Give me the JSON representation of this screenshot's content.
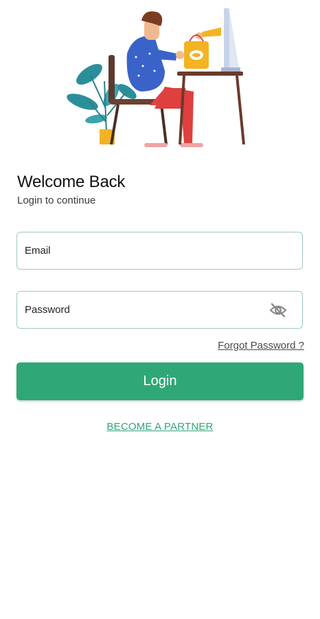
{
  "header": {
    "title": "Welcome Back",
    "subtitle": "Login to continue"
  },
  "form": {
    "email": {
      "placeholder": "Email",
      "value": ""
    },
    "password": {
      "placeholder": "Password",
      "value": "",
      "toggle_icon": "eye-off-icon"
    },
    "forgot_label": "Forgot Password ?",
    "login_label": "Login",
    "partner_label": "BECOME A PARTNER"
  },
  "theme": {
    "accent": "#2fa777",
    "field_border": "#9ccbb6",
    "background": "#ffffff"
  }
}
